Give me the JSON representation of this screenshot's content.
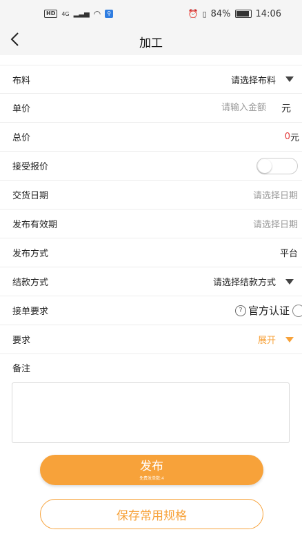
{
  "status_bar": {
    "hd_badge": "HD",
    "network": "4G",
    "battery": "84%",
    "time": "14:06"
  },
  "header": {
    "title": "加工",
    "back_icon": "chevron-left-icon"
  },
  "form": {
    "fabric": {
      "label": "布料",
      "value": "请选择布料"
    },
    "unit_price": {
      "label": "单价",
      "placeholder": "请输入金额",
      "unit": "元"
    },
    "total_price": {
      "label": "总价",
      "amount": "0",
      "unit": "元"
    },
    "accept_quote": {
      "label": "接受报价",
      "enabled": false
    },
    "delivery_date": {
      "label": "交货日期",
      "value": "请选择日期"
    },
    "validity_date": {
      "label": "发布有效期",
      "value": "请选择日期"
    },
    "publish_method": {
      "label": "发布方式",
      "value": "平台"
    },
    "payment_method": {
      "label": "结款方式",
      "value": "请选择结款方式"
    },
    "order_requirement": {
      "label": "接单要求",
      "option": "官方认证",
      "help_glyph": "?"
    },
    "requirement": {
      "label": "要求",
      "expand": "展开"
    },
    "notes": {
      "label": "备注",
      "value": ""
    }
  },
  "actions": {
    "publish_label": "发布",
    "publish_sub": "免费发单数:4",
    "save_spec_label": "保存常用规格"
  },
  "colors": {
    "accent": "#f7a23a",
    "price_red": "#e23b3b",
    "header_bg": "#f5f5f5"
  }
}
